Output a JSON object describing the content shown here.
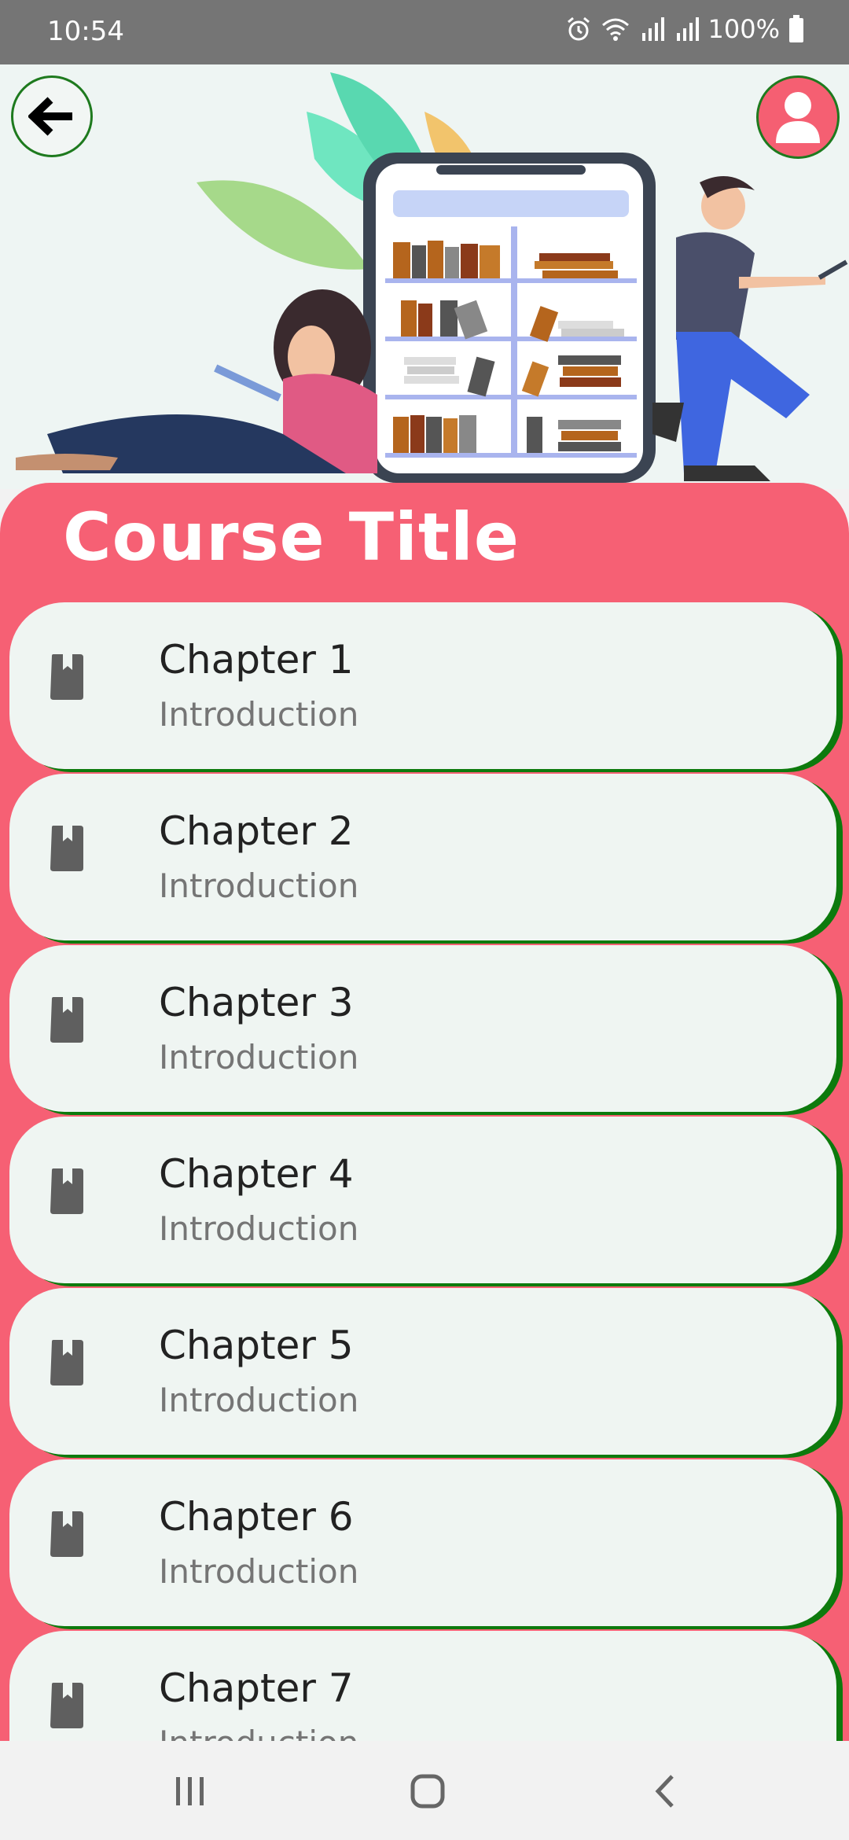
{
  "status_bar": {
    "time": "10:54",
    "battery": "100%",
    "icons": [
      "alarm-icon",
      "wifi-icon",
      "signal-icon",
      "signal-icon",
      "battery-icon"
    ]
  },
  "header": {
    "back_icon": "arrow-left-icon",
    "profile_icon": "user-icon",
    "illustration": "people-reading-phone-bookshelf"
  },
  "course": {
    "title": "Course Title"
  },
  "chapters": [
    {
      "name": "Chapter 1",
      "subtitle": "Introduction",
      "icon": "bookmark-icon"
    },
    {
      "name": "Chapter 2",
      "subtitle": "Introduction",
      "icon": "bookmark-icon"
    },
    {
      "name": "Chapter 3",
      "subtitle": "Introduction",
      "icon": "bookmark-icon"
    },
    {
      "name": "Chapter 4",
      "subtitle": "Introduction",
      "icon": "bookmark-icon"
    },
    {
      "name": "Chapter 5",
      "subtitle": "Introduction",
      "icon": "bookmark-icon"
    },
    {
      "name": "Chapter 6",
      "subtitle": "Introduction",
      "icon": "bookmark-icon"
    },
    {
      "name": "Chapter 7",
      "subtitle": "Introduction",
      "icon": "bookmark-icon"
    }
  ],
  "colors": {
    "accent": "#f66074",
    "card": "#eff5f2",
    "card_shadow": "#0d7a0d",
    "status_bar": "#757575"
  },
  "nav_bar": {
    "icons": [
      "recent-apps-icon",
      "home-icon",
      "back-icon"
    ]
  }
}
